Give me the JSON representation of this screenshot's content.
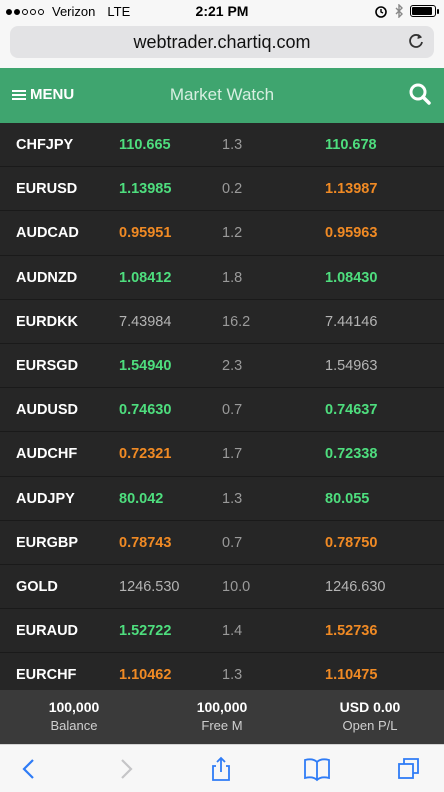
{
  "status": {
    "carrier": "Verizon",
    "network": "LTE",
    "time": "2:21 PM"
  },
  "browser": {
    "url": "webtrader.chartiq.com"
  },
  "header": {
    "menu_label": "MENU",
    "title": "Market Watch"
  },
  "market": {
    "rows": [
      {
        "symbol": "CHFJPY",
        "bid": "110.665",
        "spread": "1.3",
        "ask": "110.678",
        "bid_dir": "green",
        "ask_dir": "green"
      },
      {
        "symbol": "EURUSD",
        "bid": "1.13985",
        "spread": "0.2",
        "ask": "1.13987",
        "bid_dir": "green",
        "ask_dir": "orange"
      },
      {
        "symbol": "AUDCAD",
        "bid": "0.95951",
        "spread": "1.2",
        "ask": "0.95963",
        "bid_dir": "orange",
        "ask_dir": "orange"
      },
      {
        "symbol": "AUDNZD",
        "bid": "1.08412",
        "spread": "1.8",
        "ask": "1.08430",
        "bid_dir": "green",
        "ask_dir": "green"
      },
      {
        "symbol": "EURDKK",
        "bid": "7.43984",
        "spread": "16.2",
        "ask": "7.44146",
        "bid_dir": "neutral",
        "ask_dir": "neutral"
      },
      {
        "symbol": "EURSGD",
        "bid": "1.54940",
        "spread": "2.3",
        "ask": "1.54963",
        "bid_dir": "green",
        "ask_dir": "neutral"
      },
      {
        "symbol": "AUDUSD",
        "bid": "0.74630",
        "spread": "0.7",
        "ask": "0.74637",
        "bid_dir": "green",
        "ask_dir": "green"
      },
      {
        "symbol": "AUDCHF",
        "bid": "0.72321",
        "spread": "1.7",
        "ask": "0.72338",
        "bid_dir": "orange",
        "ask_dir": "green"
      },
      {
        "symbol": "AUDJPY",
        "bid": "80.042",
        "spread": "1.3",
        "ask": "80.055",
        "bid_dir": "green",
        "ask_dir": "green"
      },
      {
        "symbol": "EURGBP",
        "bid": "0.78743",
        "spread": "0.7",
        "ask": "0.78750",
        "bid_dir": "orange",
        "ask_dir": "orange"
      },
      {
        "symbol": "GOLD",
        "bid": "1246.530",
        "spread": "10.0",
        "ask": "1246.630",
        "bid_dir": "neutral",
        "ask_dir": "neutral"
      },
      {
        "symbol": "EURAUD",
        "bid": "1.52722",
        "spread": "1.4",
        "ask": "1.52736",
        "bid_dir": "green",
        "ask_dir": "orange"
      },
      {
        "symbol": "EURCHF",
        "bid": "1.10462",
        "spread": "1.3",
        "ask": "1.10475",
        "bid_dir": "orange",
        "ask_dir": "orange"
      }
    ]
  },
  "account": {
    "balance_value": "100,000",
    "balance_label": "Balance",
    "free_value": "100,000",
    "free_label": "Free M",
    "pl_value": "USD 0.00",
    "pl_label": "Open P/L"
  },
  "colors": {
    "header_bg": "#3fa56f",
    "up": "#4ede7e",
    "down": "#f08a24",
    "ios_blue": "#2f7cf6"
  },
  "icons": [
    "menu-icon",
    "search-icon",
    "reload-icon",
    "back-icon",
    "forward-icon",
    "share-icon",
    "bookmarks-icon",
    "tabs-icon"
  ]
}
